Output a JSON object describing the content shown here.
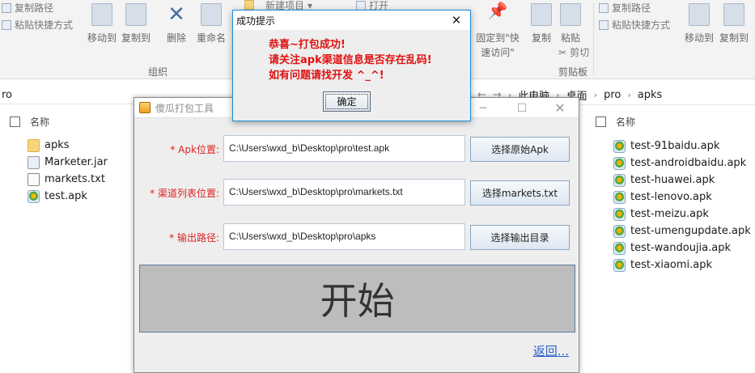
{
  "ribbon": {
    "left_small": [
      "复制路径",
      "粘贴快捷方式"
    ],
    "left_big": [
      "移动到",
      "复制到",
      "删除",
      "重命名"
    ],
    "top_partial": [
      "新建项目",
      "打开"
    ],
    "mid_big": [
      "固定到\"快速访问\"",
      "复制",
      "粘贴"
    ],
    "cut": "剪切",
    "right_small": [
      "复制路径",
      "粘贴快捷方式"
    ],
    "right_big": [
      "移动到",
      "复制到"
    ],
    "group_organize": "组织",
    "group_clipboard": "剪贴板"
  },
  "left_explorer": {
    "address": "ro",
    "column_name": "名称",
    "files": [
      {
        "name": "apks",
        "icon": "folder-icon"
      },
      {
        "name": "Marketer.jar",
        "icon": "jar-file-icon"
      },
      {
        "name": "markets.txt",
        "icon": "text-file-icon"
      },
      {
        "name": "test.apk",
        "icon": "apk-file-icon"
      }
    ]
  },
  "right_explorer": {
    "breadcrumb": [
      "此电脑",
      "桌面",
      "pro",
      "apks"
    ],
    "column_name": "名称",
    "files": [
      "test-91baidu.apk",
      "test-androidbaidu.apk",
      "test-huawei.apk",
      "test-lenovo.apk",
      "test-meizu.apk",
      "test-umengupdate.apk",
      "test-wandoujia.apk",
      "test-xiaomi.apk"
    ]
  },
  "tool": {
    "title": "傻瓜打包工具",
    "fields": [
      {
        "label": "* Apk位置:",
        "value": "C:\\Users\\wxd_b\\Desktop\\pro\\test.apk",
        "button": "选择原始Apk"
      },
      {
        "label": "* 渠道列表位置:",
        "value": "C:\\Users\\wxd_b\\Desktop\\pro\\markets.txt",
        "button": "选择markets.txt"
      },
      {
        "label": "* 输出路径:",
        "value": "C:\\Users\\wxd_b\\Desktop\\pro\\apks",
        "button": "选择输出目录"
      }
    ],
    "start_label": "开始",
    "back_label": "返回..."
  },
  "dialog": {
    "title": "成功提示",
    "lines": [
      "恭喜~打包成功!",
      "请关注apk渠道信息是否存在乱码!",
      "如有问题请找开发 ^_^!"
    ],
    "ok_label": "确定"
  },
  "colors": {
    "label_red": "#dd2222",
    "link_blue": "#2a61c9",
    "dialog_border": "#1f8ad6"
  }
}
